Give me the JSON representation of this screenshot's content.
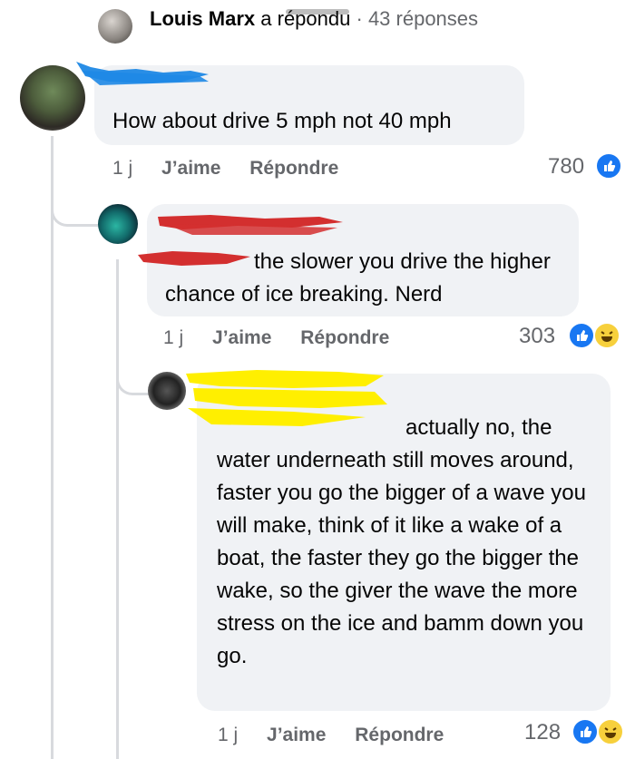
{
  "thread_header": {
    "name": "Louis Marx",
    "verb": "a répondu",
    "separator": "·",
    "replies_count": "43 réponses"
  },
  "comments": [
    {
      "text": "How about drive 5 mph not 40 mph",
      "time": "1 j",
      "like_label": "J’aime",
      "reply_label": "Répondre",
      "reaction_count": "780",
      "reactions": [
        "like-icon"
      ]
    },
    {
      "mention": "",
      "text": "the slower you drive the higher chance of ice breaking. Nerd",
      "time": "1 j",
      "like_label": "J’aime",
      "reply_label": "Répondre",
      "reaction_count": "303",
      "reactions": [
        "like-icon",
        "haha-icon"
      ]
    },
    {
      "mention": "",
      "text": "actually no, the water underneath still moves around, faster you go the bigger of a wave you will make, think of it like a wake of a boat, the faster they go the bigger the wake, so the giver the wave the more stress on the ice and bamm down you go.",
      "time": "1 j",
      "like_label": "J’aime",
      "reply_label": "Répondre",
      "reaction_count": "128",
      "reactions": [
        "like-icon",
        "haha-icon"
      ]
    }
  ],
  "colors": {
    "bubble": "#f0f2f5",
    "muted": "#65676b",
    "mention": "#216fdb",
    "like": "#1877f2",
    "haha": "#f7d03c",
    "redaction_blue": "#1e88e5",
    "redaction_red": "#d32f2f",
    "redaction_yellow": "#ffef00"
  }
}
